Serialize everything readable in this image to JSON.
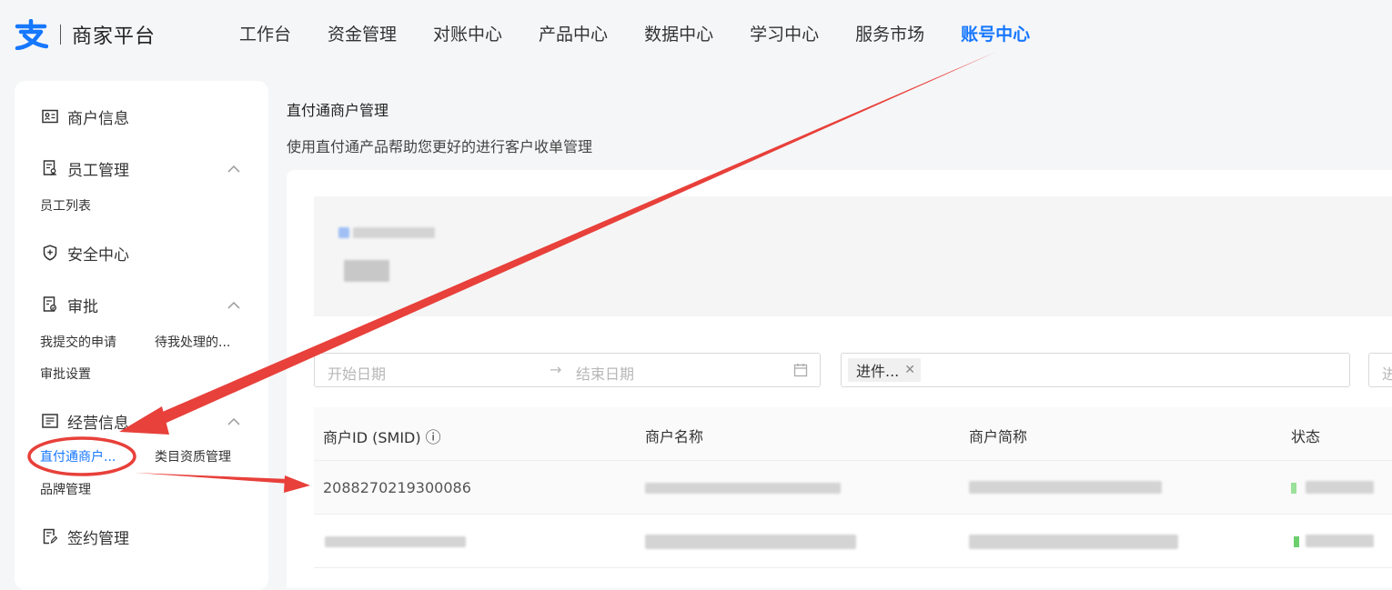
{
  "app": {
    "logo_text": "商家平台",
    "brand_color": "#1677ff"
  },
  "nav": {
    "items": [
      "工作台",
      "资金管理",
      "对账中心",
      "产品中心",
      "数据中心",
      "学习中心",
      "服务市场",
      "账号中心"
    ],
    "active_index": 7
  },
  "sidebar": {
    "merchant_info": "商户信息",
    "staff": {
      "label": "员工管理",
      "subs": [
        "员工列表"
      ]
    },
    "security": "安全中心",
    "approval": {
      "label": "审批",
      "subs": [
        "我提交的申请",
        "待我处理的...",
        "审批设置"
      ]
    },
    "business": {
      "label": "经营信息",
      "subs": [
        "直付通商户...",
        "类目资质管理",
        "品牌管理"
      ]
    },
    "contract": "签约管理"
  },
  "page": {
    "title": "直付通商户管理",
    "description": "使用直付通产品帮助您更好的进行客户收单管理"
  },
  "filters": {
    "start_placeholder": "开始日期",
    "end_placeholder": "结束日期",
    "arrow": "→",
    "status_tag": "进件...",
    "third_placeholder": "进"
  },
  "table": {
    "columns": [
      "商户ID (SMID)",
      "商户名称",
      "商户简称",
      "状态"
    ],
    "info_icon": "ⓘ",
    "rows": [
      {
        "smid": "2088270219300086"
      }
    ]
  },
  "annotation": {
    "arrow_color": "#e8403a"
  }
}
